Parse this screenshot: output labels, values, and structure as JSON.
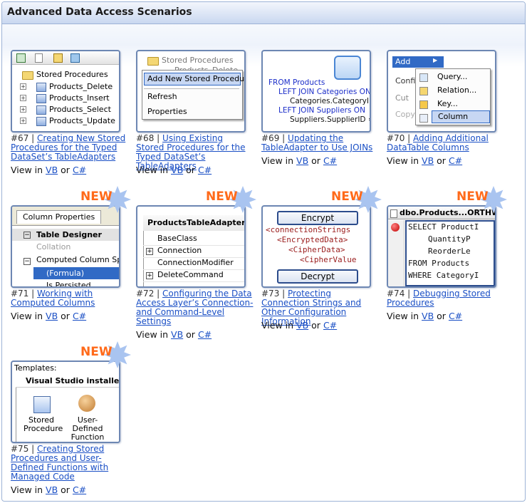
{
  "header": {
    "title": "Advanced Data Access Scenarios"
  },
  "new_badge": "NEW",
  "view_prefix": "View in",
  "view_or": "or",
  "view_vb": "VB",
  "view_cs": "C#",
  "tutorials": [
    {
      "num": "#67",
      "sep": "|",
      "title": "Creating New Stored Procedures for the Typed DataSet’s TableAdapters",
      "is_new": false,
      "thumb": {
        "items": [
          "Stored Procedures",
          "Products_Delete",
          "Products_Insert",
          "Products_Select",
          "Products_Update"
        ]
      }
    },
    {
      "num": "#68",
      "sep": "|",
      "title": "Using Existing Stored Procedures for the Typed DataSet’s TableAdapters",
      "is_new": false,
      "thumb": {
        "bg_items": [
          "Stored Procedures",
          "Products_Delete"
        ],
        "menu": [
          "Add New Stored Procedure",
          "Refresh",
          "Properties"
        ]
      }
    },
    {
      "num": "#69",
      "sep": "|",
      "title": "Updating the TableAdapter to Use JOINs",
      "is_new": false,
      "thumb": {
        "lines": [
          "FROM Products",
          "LEFT JOIN Categories ON",
          "Categories.CategoryID =",
          "LEFT JOIN Suppliers ON",
          "Suppliers.SupplierID = P"
        ]
      }
    },
    {
      "num": "#70",
      "sep": "|",
      "title": "Adding Additional DataTable Columns",
      "is_new": false,
      "thumb": {
        "menu": [
          "Add",
          "Configu",
          "Cut",
          "Copy"
        ],
        "submenu": [
          "Query...",
          "Relation...",
          "Key...",
          "Column"
        ]
      }
    },
    {
      "num": "#71",
      "sep": "|",
      "title": "Working with Computed Columns",
      "is_new": true,
      "thumb": {
        "tab": "Column Properties",
        "rows": [
          "Table Designer",
          "Collation",
          "Computed Column Speci",
          "(Formula)",
          "Is Persisted"
        ]
      }
    },
    {
      "num": "#72",
      "sep": "|",
      "title": "Configuring the Data Access Layer’s Connection- and Command-Level Settings",
      "is_new": true,
      "thumb": {
        "header": "ProductsTableAdapter",
        "rows": [
          "BaseClass",
          "Connection",
          "ConnectionModifier",
          "DeleteCommand"
        ]
      }
    },
    {
      "num": "#73",
      "sep": "|",
      "title": "Protecting Connection Strings and Other Configuration Information",
      "is_new": true,
      "thumb": {
        "btn_top": "Encrypt",
        "lines": [
          "<connectionStrings",
          "<EncryptedData>",
          "<CipherData>",
          "<CipherValue"
        ],
        "btn_bottom": "Decrypt"
      }
    },
    {
      "num": "#74",
      "sep": "|",
      "title": "Debugging Stored Procedures",
      "is_new": true,
      "thumb": {
        "title": "dbo.Products...ORTHWN",
        "lines": [
          "SELECT ProductI",
          "QuantityP",
          "ReorderLe",
          "FROM Products",
          "WHERE CategoryI"
        ]
      }
    },
    {
      "num": "#75",
      "sep": "|",
      "title": "Creating Stored Procedures and User-Defined Functions with Managed Code",
      "is_new": true,
      "thumb": {
        "label": "Templates:",
        "group": "Visual Studio installed t",
        "items": [
          "Stored Procedure",
          "User-Defined Function"
        ]
      }
    }
  ],
  "colors": {
    "accent": "#1a4fc5",
    "badge": "#ff6a1a",
    "frame": "#6d87b3"
  }
}
